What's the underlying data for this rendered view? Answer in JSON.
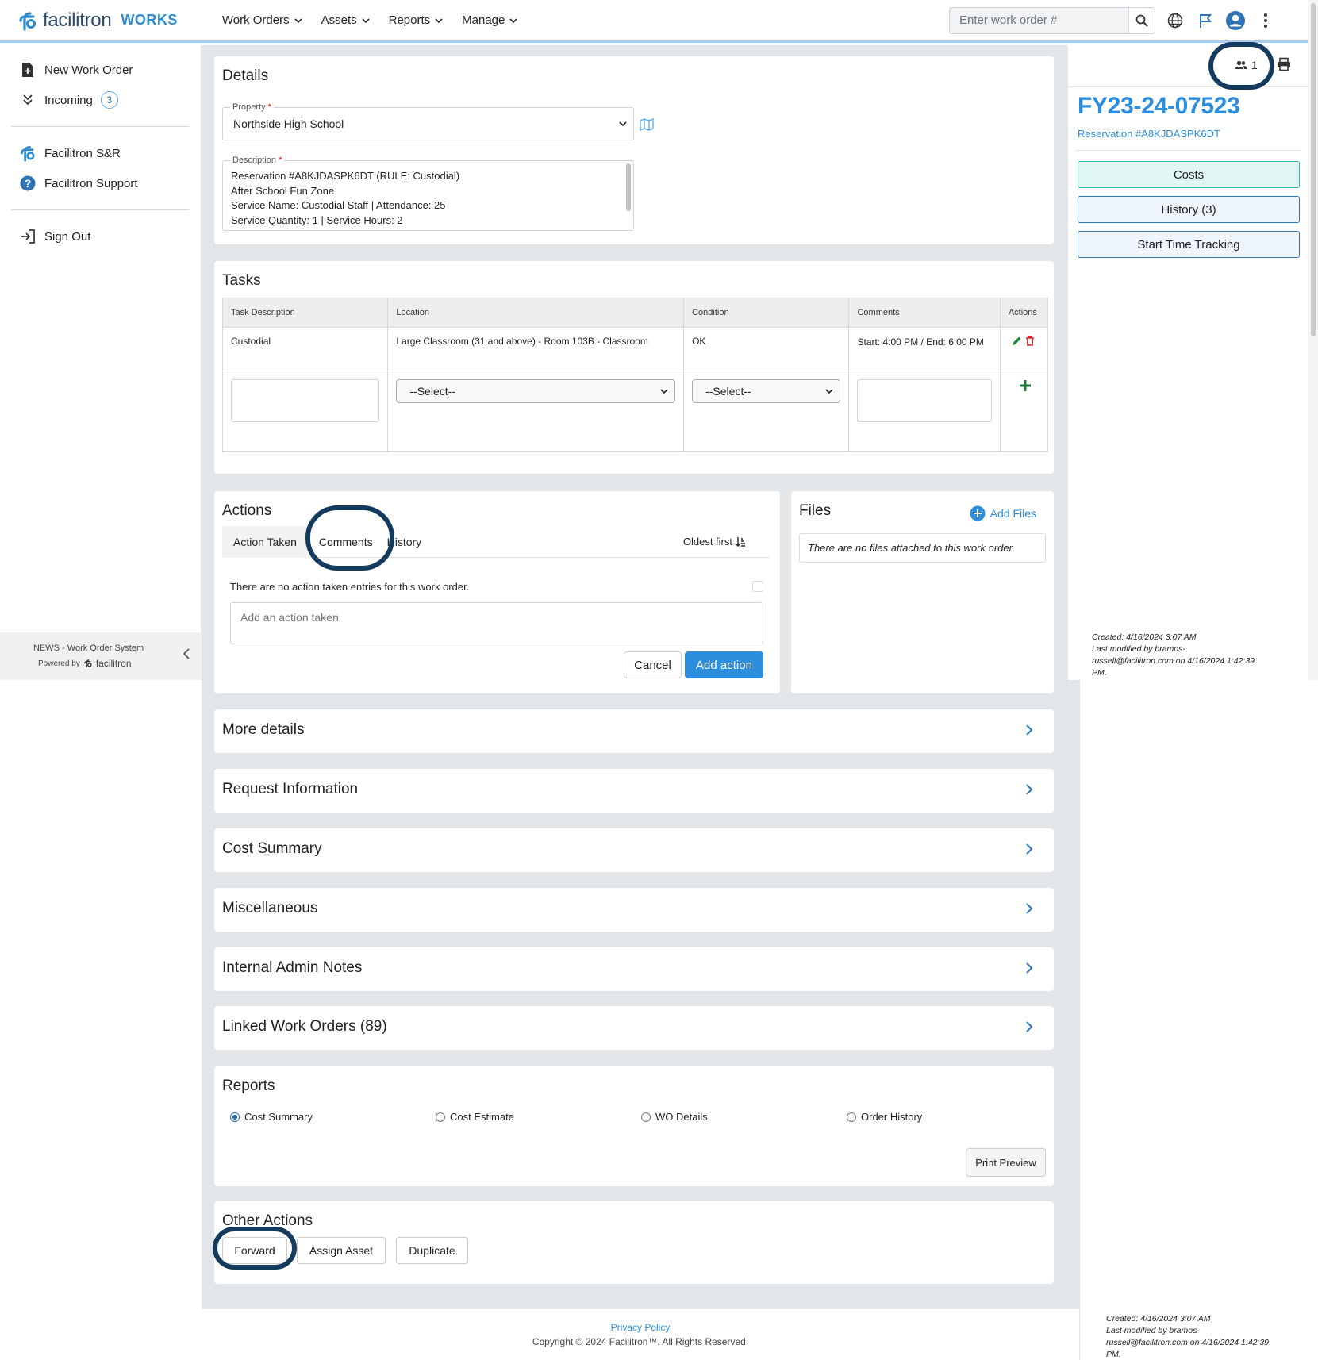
{
  "app": {
    "brand": "facilitron",
    "brand_sub": "WORKS"
  },
  "nav": {
    "menus": [
      "Work Orders",
      "Assets",
      "Reports",
      "Manage"
    ],
    "search_placeholder": "Enter work order #"
  },
  "sidebar": {
    "items": [
      {
        "label": "New Work Order",
        "icon": "new-doc-icon"
      },
      {
        "label": "Incoming",
        "icon": "double-chevron-down-icon",
        "badge": "3"
      },
      {
        "label": "Facilitron S&R",
        "icon": "facilitron-logo-icon"
      },
      {
        "label": "Facilitron Support",
        "icon": "help-icon"
      },
      {
        "label": "Sign Out",
        "icon": "sign-out-icon"
      }
    ],
    "footer_line1": "NEWS - Work Order System",
    "footer_powered": "Powered by",
    "footer_brand": "facilitron"
  },
  "details": {
    "title": "Details",
    "property_label": "Property",
    "property_value": "Northside High School",
    "description_label": "Description",
    "description_lines": [
      "Reservation #A8KJDASPK6DT (RULE: Custodial)",
      "After School Fun Zone",
      "Service Name: Custodial Staff | Attendance: 25",
      "Service Quantity: 1 | Service Hours: 2"
    ]
  },
  "tasks": {
    "title": "Tasks",
    "columns": [
      "Task Description",
      "Location",
      "Condition",
      "Comments",
      "Actions"
    ],
    "rows": [
      {
        "description": "Custodial",
        "location": "Large Classroom (31 and above) - Room 103B - Classroom",
        "condition": "OK",
        "comments": "Start: 4:00 PM / End: 6:00 PM"
      }
    ],
    "new_location_placeholder": "--Select--",
    "new_condition_placeholder": "--Select--"
  },
  "actions": {
    "title": "Actions",
    "tabs": [
      "Action Taken",
      "Comments",
      "History"
    ],
    "active_tab": "Action Taken",
    "sort_label": "Oldest first",
    "empty_text": "There are no action taken entries for this work order.",
    "input_placeholder": "Add an action taken",
    "cancel_label": "Cancel",
    "add_label": "Add action"
  },
  "files": {
    "title": "Files",
    "add_label": "Add Files",
    "empty_text": "There are no files attached to this work order."
  },
  "sections": [
    "More details",
    "Request Information",
    "Cost Summary",
    "Miscellaneous",
    "Internal Admin Notes",
    "Linked Work Orders (89)"
  ],
  "reports": {
    "title": "Reports",
    "options": [
      "Cost Summary",
      "Cost Estimate",
      "WO Details",
      "Order History"
    ],
    "selected": "Cost Summary",
    "print_label": "Print Preview"
  },
  "other_actions": {
    "title": "Other Actions",
    "buttons": [
      "Forward",
      "Assign Asset",
      "Duplicate"
    ]
  },
  "right_panel": {
    "watchers_count": "1",
    "wo_number": "FY23-24-07523",
    "reservation": "Reservation #A8KJDASPK6DT",
    "costs_label": "Costs",
    "history_label": "History (3)",
    "time_tracking_label": "Start Time Tracking",
    "meta_lines": [
      "Created: 4/16/2024 3:07 AM",
      "Last modified by bramos-",
      "russell@facilitron.com on 4/16/2024 1:42:39",
      "PM."
    ]
  },
  "footer": {
    "privacy": "Privacy Policy",
    "copyright": "Copyright © 2024 Facilitron™. All Rights Reserved."
  },
  "colors": {
    "accent": "#2e8ede",
    "highlight_ring": "#143a5e",
    "main_bg": "#e3e6e9"
  }
}
